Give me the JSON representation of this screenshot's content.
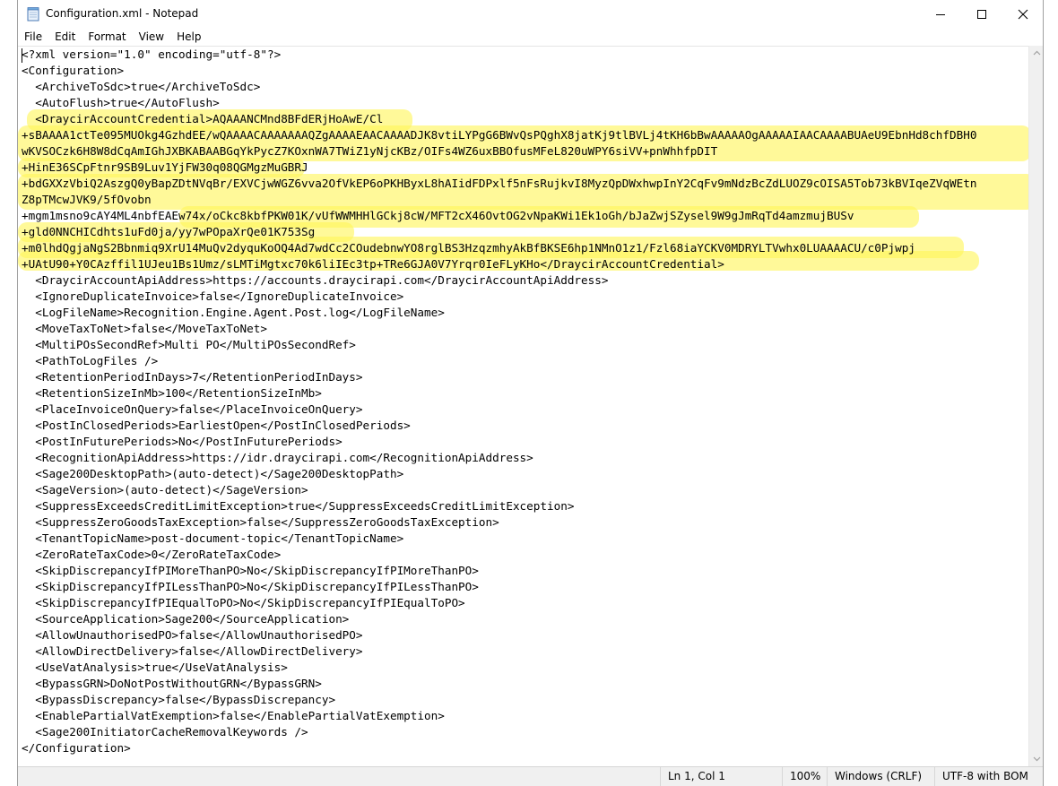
{
  "window": {
    "title": "Configuration.xml - Notepad",
    "icon": "notepad-icon",
    "controls": [
      "minimize-icon",
      "maximize-icon",
      "close-icon"
    ]
  },
  "menu": [
    "File",
    "Edit",
    "Format",
    "View",
    "Help"
  ],
  "editor": {
    "lines": [
      "<?xml version=\"1.0\" encoding=\"utf-8\"?>",
      "<Configuration>",
      "  <ArchiveToSdc>true</ArchiveToSdc>",
      "  <AutoFlush>true</AutoFlush>",
      "  <DraycirAccountCredential>AQAAANCMnd8BFdERjHoAwE/Cl",
      "+sBAAAA1ctTe095MUOkg4GzhdEE/wQAAAACAAAAAAAQZgAAAAEAACAAAADJK8vtiLYPgG6BWvQsPQghX8jatKj9tlBVLj4tKH6bBwAAAAAOgAAAAAIAACAAAABUAeU9EbnHd8chfDBH0",
      "wKVSOCzk6H8W8dCqAmIGhJXBKABAABGqYkPycZ7KOxnWA7TWiZ1yNjcKBz/OIFs4WZ6uxBBOfusMFeL820uWPY6siVV+pnWhhfpDIT",
      "+HinE36SCpFtnr9SB9Luv1YjFW30q08QGMgzMuGBRJ",
      "+bdGXXzVbiQ2AszgQ0yBapZDtNVqBr/EXVCjwWGZ6vva2OfVkEP6oPKHByxL8hAIidFDPxlf5nFsRujkvI8MyzQpDWxhwpInY2CqFv9mNdzBcZdLUOZ9cOISA5Tob73kBVIqeZVqWEtn",
      "Z8pTMcwJVK9/5fOvobn",
      "+mgm1msno9cAY4ML4nbfEAEw74x/oCkc8kbfPKW01K/vUfWWMHHlGCkj8cW/MFT2cX46OvtOG2vNpaKWi1Ek1oGh/bJaZwjSZysel9W9gJmRqTd4amzmujBUSv",
      "+gld0NNCHICdhts1uFd0ja/yy7wPOpaXrQe01K753Sg",
      "+m0lhdQgjaNgS2Bbnmiq9XrU14MuQv2dyquKoOQ4Ad7wdCc2COudebnwYO8rglBS3HzqzmhyAkBfBKSE6hp1NMnO1z1/Fzl68iaYCKV0MDRYLTVwhx0LUAAAACU/c0Pjwpj",
      "+UAtU90+Y0CAzffil1UJeu1Bs1Umz/sLMTiMgtxc70k6liIEc3tp+TRe6GJA0V7Yrqr0IeFLyKHo</DraycirAccountCredential>",
      "  <DraycirAccountApiAddress>https://accounts.draycirapi.com</DraycirAccountApiAddress>",
      "  <IgnoreDuplicateInvoice>false</IgnoreDuplicateInvoice>",
      "  <LogFileName>Recognition.Engine.Agent.Post.log</LogFileName>",
      "  <MoveTaxToNet>false</MoveTaxToNet>",
      "  <MultiPOsSecondRef>Multi PO</MultiPOsSecondRef>",
      "  <PathToLogFiles />",
      "  <RetentionPeriodInDays>7</RetentionPeriodInDays>",
      "  <RetentionSizeInMb>100</RetentionSizeInMb>",
      "  <PlaceInvoiceOnQuery>false</PlaceInvoiceOnQuery>",
      "  <PostInClosedPeriods>EarliestOpen</PostInClosedPeriods>",
      "  <PostInFuturePeriods>No</PostInFuturePeriods>",
      "  <RecognitionApiAddress>https://idr.draycirapi.com</RecognitionApiAddress>",
      "  <Sage200DesktopPath>(auto-detect)</Sage200DesktopPath>",
      "  <SageVersion>(auto-detect)</SageVersion>",
      "  <SuppressExceedsCreditLimitException>true</SuppressExceedsCreditLimitException>",
      "  <SuppressZeroGoodsTaxException>false</SuppressZeroGoodsTaxException>",
      "  <TenantTopicName>post-document-topic</TenantTopicName>",
      "  <ZeroRateTaxCode>0</ZeroRateTaxCode>",
      "  <SkipDiscrepancyIfPIMoreThanPO>No</SkipDiscrepancyIfPIMoreThanPO>",
      "  <SkipDiscrepancyIfPILessThanPO>No</SkipDiscrepancyIfPILessThanPO>",
      "  <SkipDiscrepancyIfPIEqualToPO>No</SkipDiscrepancyIfPIEqualToPO>",
      "  <SourceApplication>Sage200</SourceApplication>",
      "  <AllowUnauthorisedPO>false</AllowUnauthorisedPO>",
      "  <AllowDirectDelivery>false</AllowDirectDelivery>",
      "  <UseVatAnalysis>true</UseVatAnalysis>",
      "  <BypassGRN>DoNotPostWithoutGRN</BypassGRN>",
      "  <BypassDiscrepancy>false</BypassDiscrepancy>",
      "  <EnablePartialVatExemption>false</EnablePartialVatExemption>",
      "  <Sage200InitiatorCacheRemovalKeywords />",
      "</Configuration>"
    ],
    "highlight_color": "#fff55a"
  },
  "status": {
    "position": "Ln 1, Col 1",
    "zoom": "100%",
    "line_ending": "Windows (CRLF)",
    "encoding": "UTF-8 with BOM"
  }
}
